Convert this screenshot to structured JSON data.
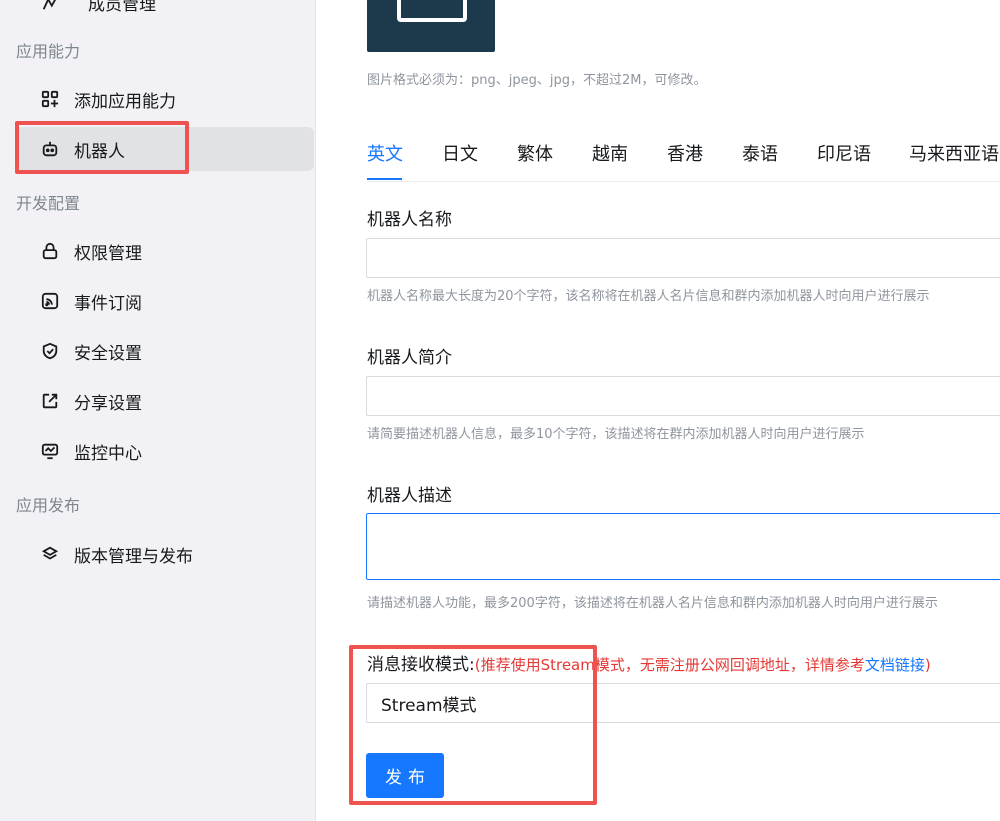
{
  "sidebar": {
    "top_partial_item": "成员管理",
    "groups": {
      "app_capability": "应用能力",
      "dev_config": "开发配置",
      "app_release": "应用发布"
    },
    "items": {
      "add_capability": "添加应用能力",
      "robot": "机器人",
      "permission": "权限管理",
      "event": "事件订阅",
      "security": "安全设置",
      "share": "分享设置",
      "monitor": "监控中心",
      "version": "版本管理与发布"
    }
  },
  "main": {
    "image_hint": "图片格式必须为：png、jpeg、jpg，不超过2M，可修改。",
    "tabs": [
      "英文",
      "日文",
      "繁体",
      "越南",
      "香港",
      "泰语",
      "印尼语",
      "马来西亚语"
    ],
    "robot_name": {
      "label": "机器人名称",
      "value": "",
      "hint": "机器人名称最大长度为20个字符，该名称将在机器人名片信息和群内添加机器人时向用户进行展示"
    },
    "robot_intro": {
      "label": "机器人简介",
      "value": "",
      "hint": "请简要描述机器人信息，最多10个字符，该描述将在群内添加机器人时向用户进行展示"
    },
    "robot_desc": {
      "label": "机器人描述",
      "value": "",
      "hint": "请描述机器人功能，最多200字符，该描述将在机器人名片信息和群内添加机器人时向用户进行展示"
    },
    "message_mode": {
      "label": "消息接收模式:",
      "rec_prefix": "(推荐使用Stream模式，无需注册公网回调地址，详情参考",
      "rec_link": "文档链接",
      "rec_suffix": ")",
      "selected": "Stream模式"
    },
    "publish_button": "发布"
  },
  "colors": {
    "accent": "#1677ff",
    "highlight": "#ef5350",
    "recommend": "#e53935"
  }
}
